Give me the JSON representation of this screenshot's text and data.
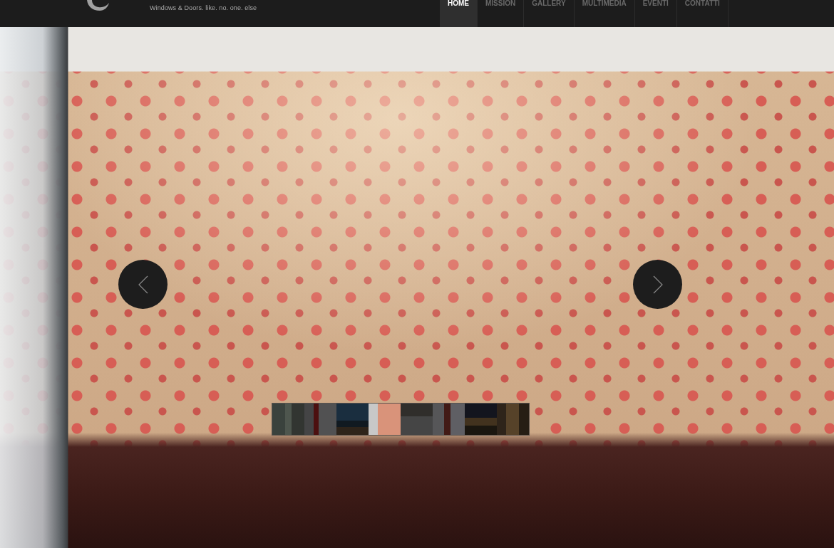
{
  "header": {
    "tagline": "Windows & Doors. like. no. one. else"
  },
  "nav": [
    {
      "label": "HOME",
      "selected": true
    },
    {
      "label": "MISSION",
      "selected": false
    },
    {
      "label": "GALLERY",
      "selected": false
    },
    {
      "label": "MULTIMEDIA",
      "selected": false
    },
    {
      "label": "EVENTI",
      "selected": false
    },
    {
      "label": "CONTATTI",
      "selected": false
    }
  ],
  "thumbnails": [
    {
      "selected": false
    },
    {
      "selected": false
    },
    {
      "selected": false
    },
    {
      "selected": true
    },
    {
      "selected": false
    },
    {
      "selected": false
    },
    {
      "selected": false
    },
    {
      "selected": false
    }
  ]
}
